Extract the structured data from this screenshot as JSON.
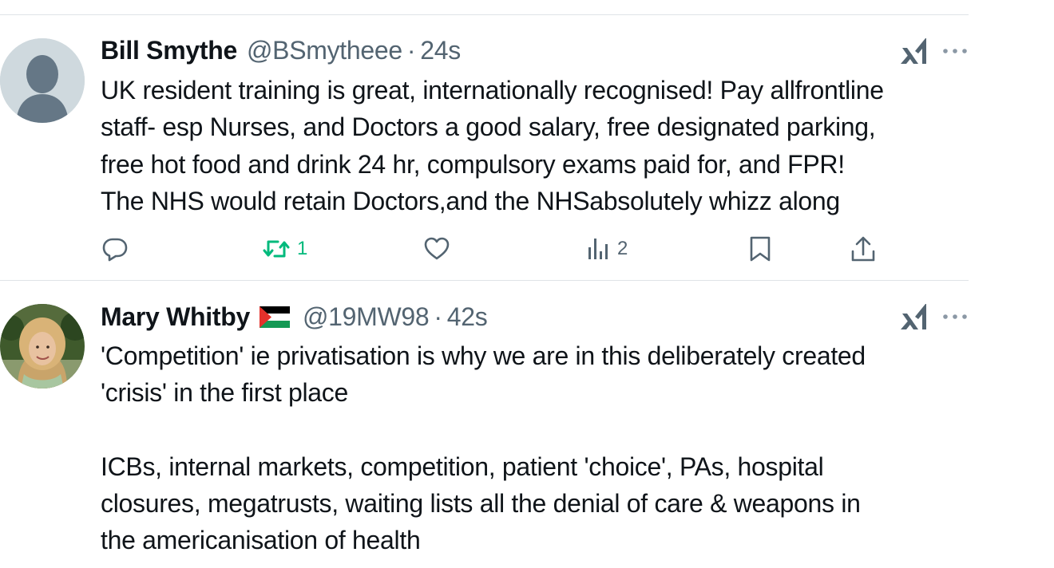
{
  "tweets": [
    {
      "display_name": "Bill Smythe",
      "handle": "@BSmytheee",
      "separator": "·",
      "time": "24s",
      "avatar": "default-avatar-icon",
      "lines": [
        "UK resident training is great, internationally recognised! Pay allfrontline",
        "staff- esp Nurses, and Doctors a good salary, free designated parking,",
        "free hot food and drink 24 hr, compulsory exams paid for, and FPR!",
        "The NHS would retain Doctors,and the NHSabsolutely whizz along"
      ],
      "actions": {
        "reply_count": "",
        "repost_count": "1",
        "like_count": "",
        "views_count": "2"
      }
    },
    {
      "display_name": "Mary Whitby",
      "flag": "palestine-flag-icon",
      "handle": "@19MW98",
      "separator": "·",
      "time": "42s",
      "avatar": "photo-avatar",
      "lines": [
        "'Competition' ie privatisation is why we are in this deliberately created",
        "'crisis' in the first place",
        "",
        "ICBs, internal markets, competition, patient 'choice', PAs, hospital",
        "closures, megatrusts, waiting lists all the denial of care & weapons in",
        "the americanisation of health"
      ]
    }
  ],
  "icons": {
    "grok": "grok-icon",
    "more": "more-options-icon",
    "reply": "reply-icon",
    "repost": "repost-icon",
    "like": "like-icon",
    "views": "views-icon",
    "bookmark": "bookmark-icon",
    "share": "share-icon"
  },
  "colors": {
    "text": "#0f1419",
    "secondary": "#536471",
    "repost_active": "#00ba7c",
    "divider": "#dfe3e7",
    "default_avatar_bg": "#cfd9de"
  }
}
